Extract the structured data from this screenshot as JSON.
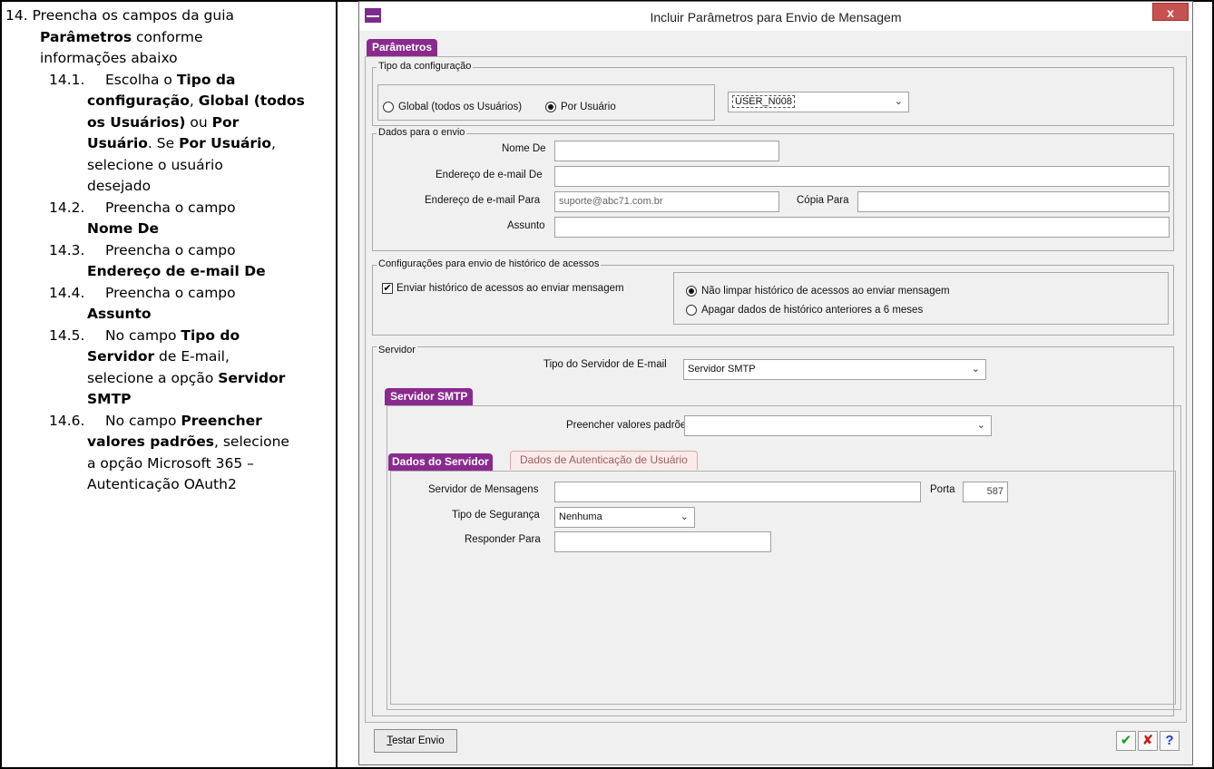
{
  "instructions": {
    "item14": {
      "num": "14.",
      "t1": "Preencha os campos da guia",
      "b1": "Parâmetros",
      "t2": " conforme",
      "t3": "informações abaixo"
    },
    "s1": {
      "num": "14.1.",
      "t1": "Escolha o ",
      "b1": "Tipo da",
      "b2": "configuração",
      "t2": ", ",
      "b3": "Global (todos",
      "b4": "os Usuários)",
      "t3": " ou ",
      "b5": "Por",
      "b6": "Usuário",
      "t4": ". Se ",
      "b7": "Por Usuário",
      "t5": ",",
      "t6": "selecione o usuário",
      "t7": "desejado"
    },
    "s2": {
      "num": "14.2.",
      "t1": "Preencha o campo",
      "b1": "Nome De"
    },
    "s3": {
      "num": "14.3.",
      "t1": "Preencha o campo",
      "b1": "Endereço de e-mail De"
    },
    "s4": {
      "num": "14.4.",
      "t1": "Preencha o campo",
      "b1": "Assunto"
    },
    "s5": {
      "num": "14.5.",
      "t1": "No campo ",
      "b1": "Tipo do",
      "b2": "Servidor",
      "t2": " de E-mail,",
      "t3": "selecione a opção ",
      "b3": "Servidor",
      "b4": "SMTP"
    },
    "s6": {
      "num": "14.6.",
      "t1": "No campo ",
      "b1": "Preencher",
      "b2": "valores padrões",
      "t2": ", selecione",
      "t3": "a opção Microsoft 365 –",
      "t4": "Autenticação OAuth2"
    }
  },
  "dialog": {
    "title": "Incluir Parâmetros para Envio de Mensagem",
    "close": "x",
    "tab_parametros": "Parâmetros",
    "tipo_config": {
      "title": "Tipo da configuração",
      "global_label": "Global (todos os Usuários)",
      "por_usuario_label": "Por Usuário",
      "selected": "Por Usuário",
      "user_value": "USER_N008"
    },
    "dados_envio": {
      "title": "Dados para o envio",
      "nome_de_label": "Nome De",
      "nome_de_value": "",
      "email_de_label": "Endereço de e-mail De",
      "email_de_value": "",
      "email_para_label": "Endereço de e-mail Para",
      "email_para_value": "suporte@abc71.com.br",
      "copia_para_label": "Cópia Para",
      "copia_para_value": "",
      "assunto_label": "Assunto",
      "assunto_value": ""
    },
    "historico": {
      "title": "Configurações para envio de histórico de acessos",
      "enviar_label": "Enviar histórico de acessos ao enviar mensagem",
      "enviar_checked": true,
      "nao_limpar_label": "Não limpar histórico de acessos ao enviar mensagem",
      "apagar_label": "Apagar dados de histórico anteriores a 6 meses",
      "selected": "Não limpar histórico de acessos ao enviar mensagem"
    },
    "servidor": {
      "title": "Servidor",
      "tipo_label": "Tipo do Servidor de E-mail",
      "tipo_value": "Servidor SMTP",
      "tab_smtp": "Servidor SMTP",
      "preencher_label": "Preencher valores padrões",
      "preencher_value": "",
      "tab_dados_servidor": "Dados do Servidor",
      "tab_dados_auth": "Dados de Autenticação de Usuário",
      "servidor_msg_label": "Servidor de Mensagens",
      "servidor_msg_value": "",
      "porta_label": "Porta",
      "porta_value": "587",
      "seguranca_label": "Tipo de Segurança",
      "seguranca_value": "Nenhuma",
      "responder_label": "Responder Para",
      "responder_value": ""
    },
    "footer": {
      "test_label_first": "T",
      "test_label_rest": "estar Envio",
      "ok": "✔",
      "cancel": "✘",
      "help": "?"
    }
  }
}
